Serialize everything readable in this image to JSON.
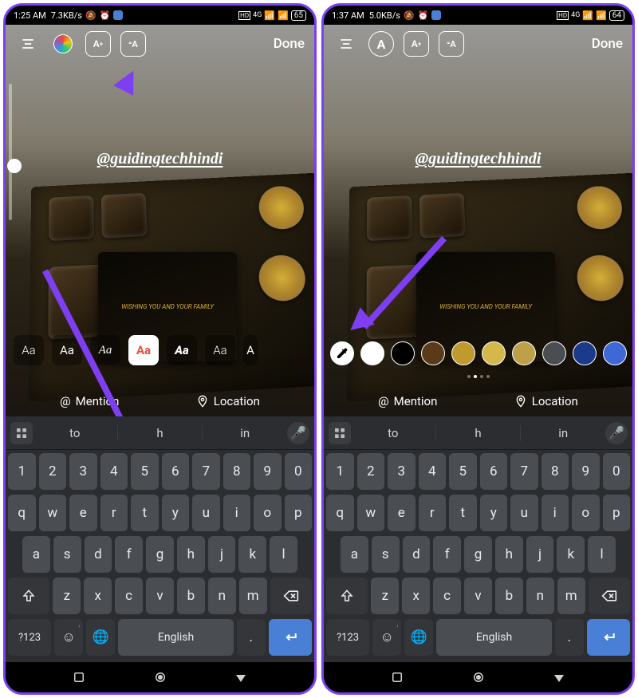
{
  "screens": [
    {
      "status": {
        "time": "1:25 AM",
        "net": "7.3KB/s",
        "signal": "4G",
        "battery": "65"
      },
      "toolbar": {
        "align": "align",
        "color_wheel": true,
        "font_size": "A+",
        "bg_toggle": "=A",
        "done": "Done"
      },
      "mention": "@guidingtechhindi",
      "font_options": [
        "Aa",
        "Aa",
        "Aa",
        "Aa",
        "Aa",
        "Aa",
        "A"
      ],
      "font_active_index": 3,
      "suggestions": {
        "mention": "Mention",
        "location": "Location"
      },
      "arrow_to": "color-wheel"
    },
    {
      "status": {
        "time": "1:37 AM",
        "net": "5.0KB/s",
        "signal": "4G",
        "battery": "64"
      },
      "toolbar": {
        "align": "align",
        "letter_circle": "A",
        "font_size": "A+",
        "bg_toggle": "=A",
        "done": "Done"
      },
      "mention": "@guidingtechhindi",
      "color_swatches": [
        {
          "type": "eyedropper"
        },
        {
          "color": "#ffffff"
        },
        {
          "color": "#000000"
        },
        {
          "color": "#5b3a1a"
        },
        {
          "color": "#c19a2e"
        },
        {
          "color": "#d4b94a"
        },
        {
          "color": "#bfa04a"
        },
        {
          "color": "#4a4d52"
        },
        {
          "color": "#1b3a8a"
        },
        {
          "color": "#3e68d6"
        }
      ],
      "page_indicator": {
        "count": 4,
        "active": 1
      },
      "suggestions": {
        "mention": "Mention",
        "location": "Location"
      },
      "arrow_to": "eyedropper"
    }
  ],
  "keyboard": {
    "suggestions": [
      "to",
      "h",
      "in"
    ],
    "row_num": [
      "1",
      "2",
      "3",
      "4",
      "5",
      "6",
      "7",
      "8",
      "9",
      "0"
    ],
    "row1": [
      "q",
      "w",
      "e",
      "r",
      "t",
      "y",
      "u",
      "i",
      "o",
      "p"
    ],
    "row2": [
      "a",
      "s",
      "d",
      "f",
      "g",
      "h",
      "j",
      "k",
      "l"
    ],
    "row3": [
      "z",
      "x",
      "c",
      "v",
      "b",
      "n",
      "m"
    ],
    "sym_key": "?123",
    "space_label": "English",
    "comma": ",",
    "period": "."
  },
  "nav": {
    "back": "back",
    "home": "home",
    "recents": "recents"
  }
}
